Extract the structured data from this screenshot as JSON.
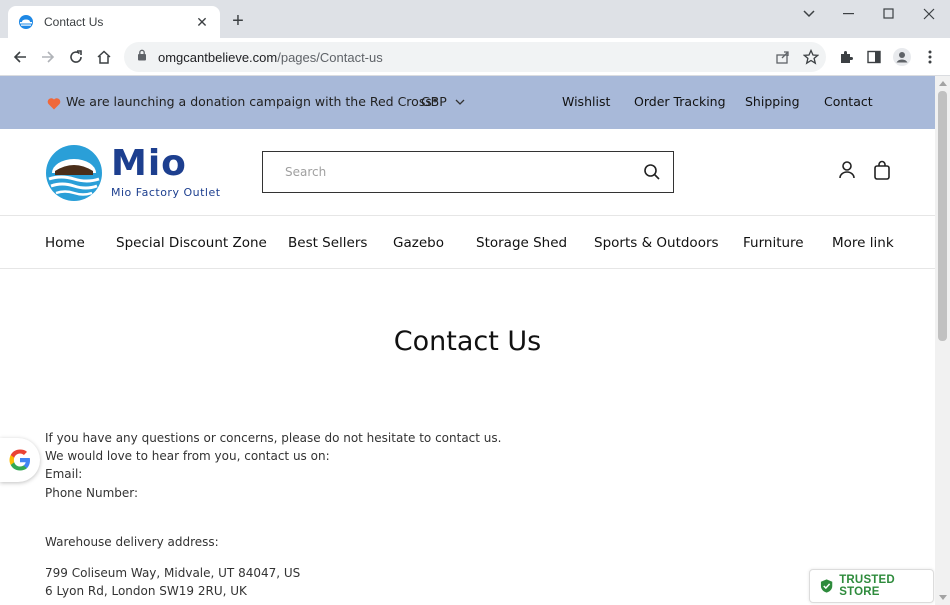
{
  "browser": {
    "tab_title": "Contact Us",
    "url_domain": "omgcantbelieve.com",
    "url_path": "/pages/Contact-us"
  },
  "announcement": {
    "message": "We are launching a donation campaign with the Red Cross*",
    "currency": "GBP",
    "links": [
      "Wishlist",
      "Order Tracking",
      "Shipping",
      "Contact"
    ]
  },
  "logo": {
    "word": "Mio",
    "subtitle": "Mio Factory Outlet"
  },
  "search": {
    "placeholder": "Search"
  },
  "nav": {
    "items": [
      "Home",
      "Special Discount Zone",
      "Best Sellers",
      "Gazebo",
      "Storage Shed",
      "Sports & Outdoors",
      "Furniture",
      "More link"
    ]
  },
  "page": {
    "title": "Contact Us",
    "lines": [
      "If you have any questions or concerns, please do not hesitate to contact us.",
      "We would love to hear from you, contact us on:",
      "Email:",
      "Phone Number:"
    ],
    "warehouse_label": "Warehouse delivery address:",
    "addresses": [
      "799 Coliseum Way, Midvale, UT 84047, US",
      "6 Lyon Rd, London SW19 2RU, UK"
    ]
  },
  "badges": {
    "trusted_store": "TRUSTED STORE"
  },
  "colors": {
    "announcement_bg": "#a8b9d9",
    "brand_blue": "#1d3f8f",
    "trusted_green": "#2e8b3c",
    "heart": "#f0683a"
  }
}
